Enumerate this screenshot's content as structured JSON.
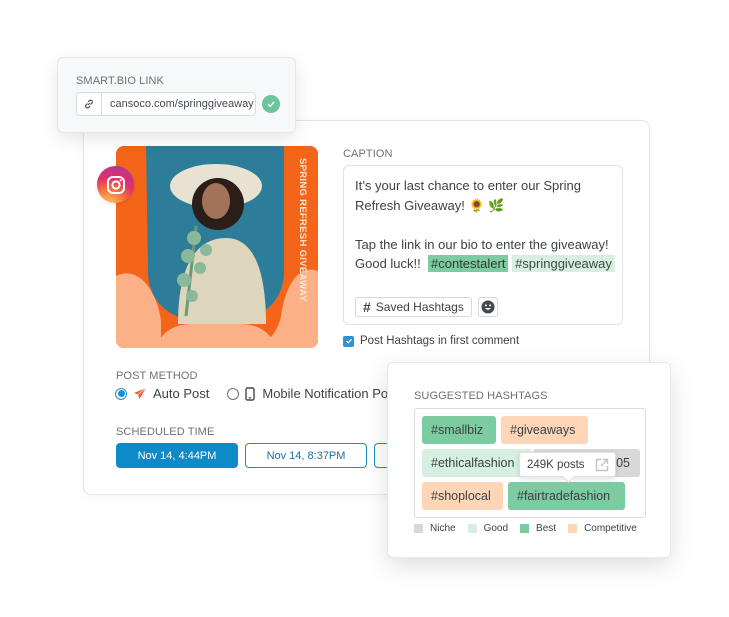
{
  "smart_bio": {
    "label": "SMART.BIO LINK",
    "link_icon": "link-icon",
    "url_value": "cansoco.com/springgiveaway",
    "status_icon": "check-circle-icon",
    "status_color": "#6cc59a"
  },
  "post": {
    "network_icon": "instagram-icon",
    "image_alt": "Woman in sun hat holding eucalyptus on blue background, orange frame",
    "image_overlay_text": "SPRING REFRESH GIVEAWAY",
    "frame_color": "#f4651a",
    "frame_accent_color": "#fbb088",
    "photo_bg_color": "#2d7d9a"
  },
  "caption": {
    "label": "CAPTION",
    "line1": "It’s your last chance to enter our Spring",
    "line2_text": "Refresh Giveaway!",
    "line2_emoji": "🌻 🌿",
    "line3": "Tap the link in our bio to enter the giveaway!",
    "line4_text": "Good luck!!",
    "hashtags": [
      {
        "text": "#contestalert",
        "rating": "best"
      },
      {
        "text": "#springgiveaway",
        "rating": "good"
      }
    ],
    "saved_hashtags_label": "Saved Hashtags",
    "emoji_icon": "emoji-icon",
    "first_comment_label": "Post Hashtags in first comment",
    "first_comment_checked": true
  },
  "post_method": {
    "label": "POST METHOD",
    "options": [
      {
        "label": "Auto Post",
        "icon": "paper-plane-icon",
        "selected": true
      },
      {
        "label": "Mobile Notification Post",
        "icon": "mobile-phone-icon",
        "selected": false
      }
    ]
  },
  "scheduled_time": {
    "label": "SCHEDULED TIME",
    "options": [
      {
        "label": "Nov 14, 4:44PM",
        "selected": true
      },
      {
        "label": "Nov 14, 8:37PM",
        "selected": false
      },
      {
        "label": "",
        "selected": false
      }
    ]
  },
  "suggested_hashtags": {
    "label": "SUGGESTED HASHTAGS",
    "tags": [
      {
        "text": "#smallbiz",
        "rating": "best"
      },
      {
        "text": "#giveaways",
        "rating": "competitive"
      },
      {
        "text": "#ethicalfashion",
        "rating": "good"
      },
      {
        "text": "05",
        "rating": "niche"
      },
      {
        "text": "#shoplocal",
        "rating": "competitive"
      },
      {
        "text": "#fairtradefashion",
        "rating": "best"
      }
    ],
    "tooltip": {
      "text": "249K posts",
      "icon": "external-link-icon"
    },
    "legend": [
      {
        "label": "Niche",
        "color": "#d8d8d8"
      },
      {
        "label": "Good",
        "color": "#d6efe2"
      },
      {
        "label": "Best",
        "color": "#7dcba0"
      },
      {
        "label": "Competitive",
        "color": "#fed5b6"
      }
    ]
  },
  "colors": {
    "primary": "#0f8ac8",
    "best": "#7dcba0",
    "good": "#d6efe2",
    "competitive": "#fed5b6",
    "niche": "#d8d8d8"
  }
}
